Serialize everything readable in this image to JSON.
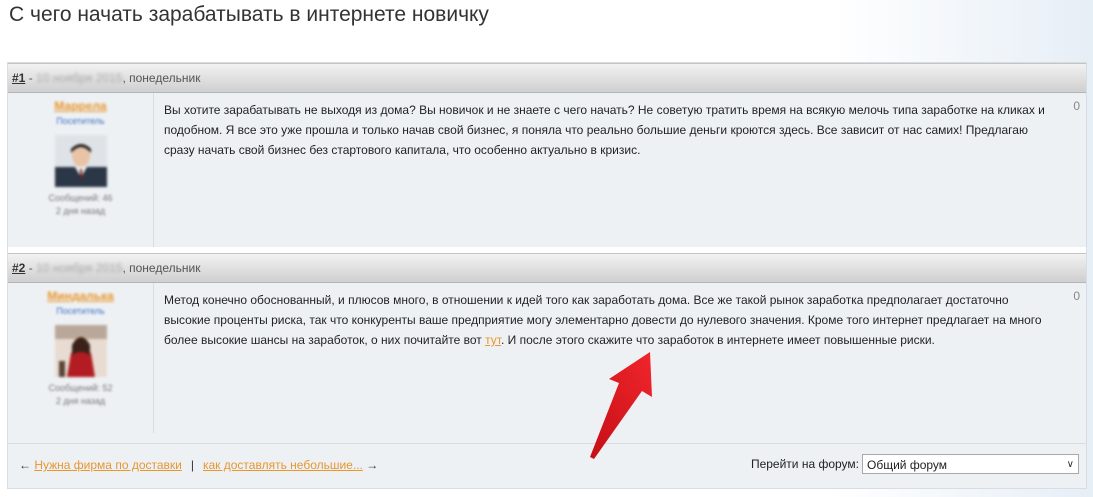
{
  "page_title": "С чего начать зарабатывать в интернете новичку",
  "posts": [
    {
      "num": "#1",
      "dash": " - ",
      "date": "10 ноября 2015",
      "weekday": ", понедельник",
      "author": "Маррела",
      "role": "Посетитель",
      "messages": "Сообщений: 46",
      "ago": "2 дня назад",
      "rating": "0",
      "text": "Вы хотите зарабатывать не выходя из дома? Вы новичок и не знаете с чего начать? Не советую тратить время на всякую мелочь типа заработке на кликах и подобном. Я все это уже прошла и только начав свой бизнес, я поняла что реально большие деньги кроются здесь. Все зависит от нас самих! Предлагаю сразу начать свой бизнес без стартового капитала, что особенно актуально в кризис."
    },
    {
      "num": "#2",
      "dash": " - ",
      "date": "10 ноября 2015",
      "weekday": ", понедельник",
      "author": "Миндалька",
      "role": "Посетитель",
      "messages": "Сообщений: 52",
      "ago": "2 дня назад",
      "rating": "0",
      "text_before": "Метод конечно обоснованный, и плюсов много, в отношении к идей того как заработать дома. Все же такой рынок заработка предполагает достаточно высокие проценты риска, так что конкуренты ваше предприятие могу элементарно довести до нулевого значения. Кроме того интернет предлагает на много более высокие шансы на заработок, о них почитайте вот ",
      "link": "тут",
      "text_after": ". И после этого скажите что заработок в интернете имеет повышенные риски."
    }
  ],
  "footer": {
    "prev_arrow": "←",
    "prev_link": "Нужна фирма по доставки",
    "divider": "|",
    "next_link": "как доставлять небольшие...",
    "next_arrow": "→",
    "forum_label": "Перейти на форум:",
    "forum_selected": "Общий форум",
    "chevron": "∨"
  },
  "colors": {
    "accent_link": "#e8962e",
    "arrow_annotation": "#e0141b"
  }
}
